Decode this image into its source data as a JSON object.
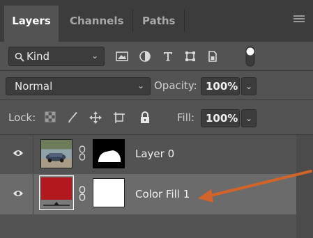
{
  "tabs": [
    {
      "label": "Layers",
      "active": true
    },
    {
      "label": "Channels",
      "active": false
    },
    {
      "label": "Paths",
      "active": false
    }
  ],
  "filter": {
    "kind_label": "Kind",
    "icons": [
      "image-filter-icon",
      "adjustment-filter-icon",
      "type-filter-icon",
      "shape-filter-icon",
      "smart-object-filter-icon",
      "filter-toggle-icon"
    ]
  },
  "blend": {
    "mode": "Normal",
    "opacity_label": "Opacity:",
    "opacity_value": "100%"
  },
  "lock": {
    "label": "Lock:",
    "fill_label": "Fill:",
    "fill_value": "100%"
  },
  "layers": [
    {
      "name": "Layer 0",
      "selected": false
    },
    {
      "name": "Color Fill 1",
      "selected": true
    }
  ],
  "colors": {
    "panel_bg": "#535353",
    "tab_bar": "#3c3c3c",
    "selected_row": "#6b6b6b",
    "fill_swatch": "#b2181e",
    "annotation_arrow": "#d2642a"
  }
}
